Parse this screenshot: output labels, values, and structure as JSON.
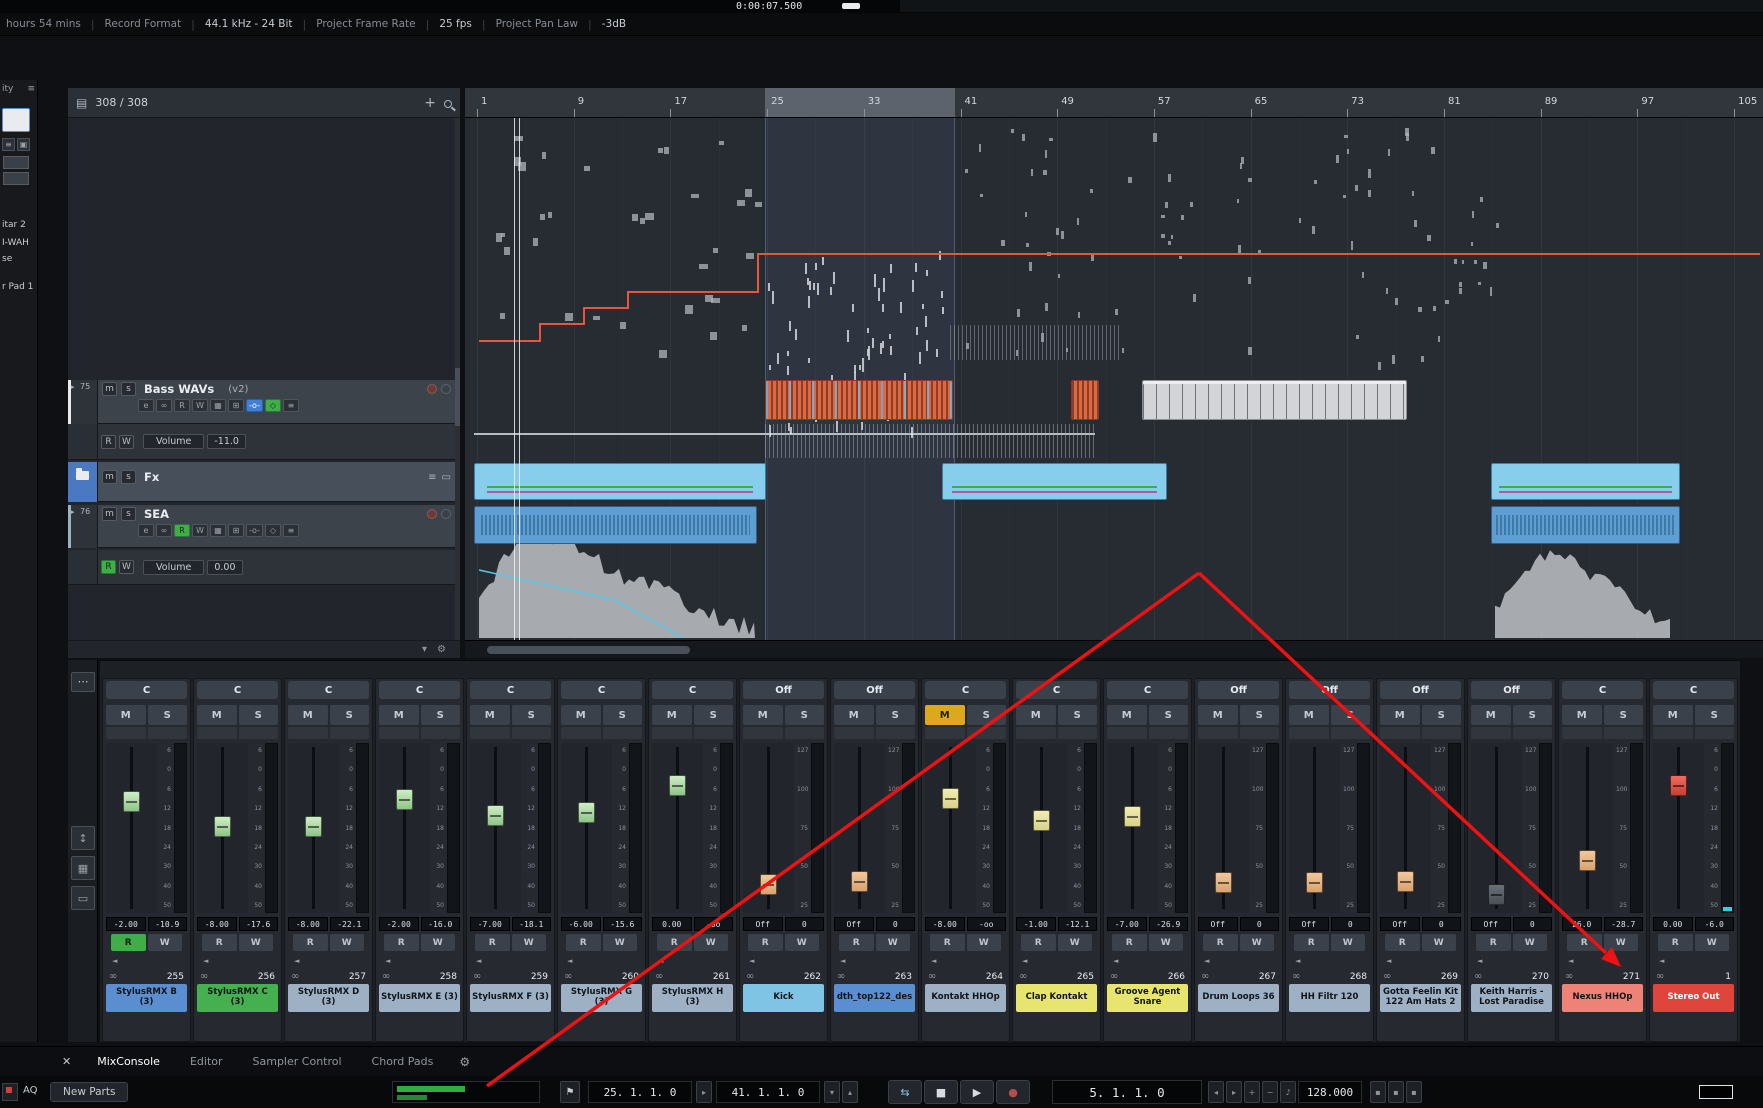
{
  "glyphs": {
    "sep": "|",
    "close": "✕",
    "plus": "+",
    "minus": "−",
    "grid": "▤",
    "gear": "⚙",
    "menu": "≡",
    "down": "▾",
    "up": "▴",
    "arrow": "▸",
    "arrow_left": "◂",
    "pad": "▭",
    "panel": "▦",
    "updown": "↕",
    "dots": "⋯",
    "speaker": "◄",
    "stereo": "∞",
    "cycle": "⇆",
    "stop": "■",
    "play": "▶",
    "record": "●",
    "flag": "⚑",
    "note": "♪",
    "small": "▪"
  },
  "topbar": {
    "time": "0:00:07.500",
    "items": [
      {
        "label": "hours 54 mins",
        "bright": false
      },
      {
        "label": "Record Format",
        "bright": false
      },
      {
        "label": "44.1 kHz - 24 Bit",
        "bright": true
      },
      {
        "label": "Project Frame Rate",
        "bright": false
      },
      {
        "label": "25 fps",
        "bright": true
      },
      {
        "label": "Project Pan Law",
        "bright": false
      },
      {
        "label": "-3dB",
        "bright": true
      }
    ]
  },
  "sidebar": {
    "title": "ity",
    "fragments": [
      "itar 2",
      "I-WAH",
      "se",
      "r Pad 1"
    ]
  },
  "tracklist": {
    "counter": "308 / 308",
    "bass": {
      "num": "75",
      "mute": "m",
      "solo": "s",
      "name": "Bass WAVs",
      "tag": "(v2)",
      "buttons": [
        {
          "t": "e"
        },
        {
          "t": "∞"
        },
        {
          "t": "R"
        },
        {
          "t": "W"
        },
        {
          "t": "▦"
        },
        {
          "t": "⊞"
        },
        {
          "t": "-o-",
          "on": "blue"
        },
        {
          "t": "◇",
          "on": "green"
        },
        {
          "t": "≡"
        }
      ],
      "auto_r": "R",
      "auto_w": "W",
      "param": "Volume",
      "value": "-11.0"
    },
    "fx": {
      "mute": "m",
      "solo": "s",
      "name": "Fx"
    },
    "sea": {
      "num": "76",
      "mute": "m",
      "solo": "s",
      "name": "SEA",
      "buttons": [
        {
          "t": "e"
        },
        {
          "t": "∞"
        },
        {
          "t": "R",
          "on": "green"
        },
        {
          "t": "W"
        },
        {
          "t": "▦"
        },
        {
          "t": "⊞"
        },
        {
          "t": "-o-"
        },
        {
          "t": "◇"
        },
        {
          "t": "≡"
        }
      ],
      "auto_r": "R",
      "auto_w": "W",
      "param": "Volume",
      "value": "0.00"
    }
  },
  "ruler": {
    "marks": [
      "1",
      "9",
      "17",
      "25",
      "33",
      "41",
      "49",
      "57",
      "65",
      "73",
      "81",
      "89",
      "97",
      "105"
    ]
  },
  "mixer": {
    "labels": {
      "m": "M",
      "s": "S",
      "r": "R",
      "w": "W"
    },
    "scale_audio": [
      "6",
      "0",
      "6",
      "12",
      "18",
      "24",
      "30",
      "40",
      "50"
    ],
    "scale_midi": [
      "127",
      "100",
      "75",
      "50",
      "25"
    ],
    "channels": [
      {
        "num": "255",
        "name": "StylusRMX B (3)",
        "top": "C",
        "vol": "-2.00",
        "peak": "-10.9",
        "kind": "audio",
        "color": "#5b8ed1",
        "fader": "green",
        "pos": 0.31,
        "r_on": true
      },
      {
        "num": "256",
        "name": "StylusRMX C (3)",
        "top": "C",
        "vol": "-8.00",
        "peak": "-17.6",
        "kind": "audio",
        "color": "#44b14e",
        "fader": "green",
        "pos": 0.49
      },
      {
        "num": "257",
        "name": "StylusRMX D (3)",
        "top": "C",
        "vol": "-8.00",
        "peak": "-22.1",
        "kind": "audio",
        "color": "#9db0c4",
        "fader": "green",
        "pos": 0.49
      },
      {
        "num": "258",
        "name": "StylusRMX E (3)",
        "top": "C",
        "vol": "-2.00",
        "peak": "-16.0",
        "kind": "audio",
        "color": "#9db0c4",
        "fader": "green",
        "pos": 0.3
      },
      {
        "num": "259",
        "name": "StylusRMX F (3)",
        "top": "C",
        "vol": "-7.00",
        "peak": "-18.1",
        "kind": "audio",
        "color": "#9db0c4",
        "fader": "green",
        "pos": 0.41
      },
      {
        "num": "260",
        "name": "StylusRMX G (3)",
        "top": "C",
        "vol": "-6.00",
        "peak": "-15.6",
        "kind": "audio",
        "color": "#9db0c4",
        "fader": "green",
        "pos": 0.39
      },
      {
        "num": "261",
        "name": "StylusRMX H (3)",
        "top": "C",
        "vol": "0.00",
        "peak": "-oo",
        "kind": "audio",
        "color": "#9db0c4",
        "fader": "green",
        "pos": 0.2
      },
      {
        "num": "262",
        "name": "Kick",
        "top": "Off",
        "vol": "Off",
        "peak": "0",
        "kind": "midi",
        "color": "#7fc4e4",
        "fader": "orange",
        "pos": 0.9
      },
      {
        "num": "263",
        "name": "dth_top122_des",
        "top": "Off",
        "vol": "Off",
        "peak": "0",
        "kind": "midi",
        "color": "#5b8ed1",
        "fader": "orange",
        "pos": 0.88
      },
      {
        "num": "264",
        "name": "Kontakt HHOp",
        "top": "C",
        "vol": "-8.00",
        "peak": "-oo",
        "kind": "audio",
        "color": "#9db0c4",
        "fader": "yellow",
        "pos": 0.29,
        "muted": true
      },
      {
        "num": "265",
        "name": "Clap Kontakt",
        "top": "C",
        "vol": "-1.00",
        "peak": "-12.1",
        "kind": "audio",
        "color": "#e8e56e",
        "fader": "yellow",
        "pos": 0.45
      },
      {
        "num": "266",
        "name": "Groove Agent Snare",
        "top": "C",
        "vol": "-7.00",
        "peak": "-26.9",
        "kind": "audio",
        "color": "#e8e56e",
        "fader": "yellow",
        "pos": 0.42
      },
      {
        "num": "267",
        "name": "Drum Loops 36",
        "top": "Off",
        "vol": "Off",
        "peak": "0",
        "kind": "midi",
        "color": "#9db0c4",
        "fader": "orange",
        "pos": 0.89
      },
      {
        "num": "268",
        "name": "HH Filtr 120",
        "top": "Off",
        "vol": "Off",
        "peak": "0",
        "kind": "midi",
        "color": "#9db0c4",
        "fader": "orange",
        "pos": 0.89
      },
      {
        "num": "269",
        "name": "Gotta Feelin Kit 122 Am Hats 2",
        "top": "Off",
        "vol": "Off",
        "peak": "0",
        "kind": "midi",
        "color": "#9db0c4",
        "fader": "orange",
        "pos": 0.88
      },
      {
        "num": "270",
        "name": "Keith Harris - Lost Paradise",
        "top": "Off",
        "vol": "Off",
        "peak": "0",
        "kind": "midi",
        "color": "#9db0c4",
        "fader": "dark",
        "pos": 0.97
      },
      {
        "num": "271",
        "name": "Nexus HHOp",
        "top": "C",
        "vol": "26.0",
        "peak": "-28.7",
        "kind": "midi",
        "color": "#ef8277",
        "fader": "orange",
        "pos": 0.73
      },
      {
        "num": "1",
        "name": "Stereo Out",
        "top": "C",
        "vol": "0.00",
        "peak": "-6.0",
        "kind": "audio",
        "color": "#e0453c",
        "text_light": true,
        "fader": "red",
        "pos": 0.2,
        "meter_cyan": true
      }
    ]
  },
  "tabs": {
    "close": "✕",
    "items": [
      "MixConsole",
      "Editor",
      "Sampler Control",
      "Chord Pads"
    ],
    "active": "MixConsole"
  },
  "transport": {
    "aq": "AQ",
    "new_parts": "New Parts",
    "left_locator": "25. 1. 1. 0",
    "right_locator": "41. 1. 1. 0",
    "position": "5. 1. 1. 0",
    "tempo": "128.000"
  }
}
